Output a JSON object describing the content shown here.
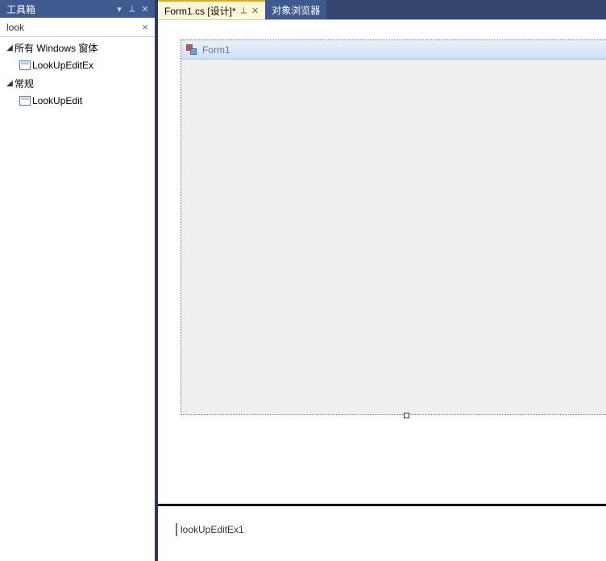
{
  "toolbox": {
    "title": "工具箱",
    "search_value": "look",
    "groups": [
      {
        "label": "所有 Windows 窗体",
        "items": [
          {
            "label": "LookUpEditEx"
          }
        ]
      },
      {
        "label": "常规",
        "items": [
          {
            "label": "LookUpEdit"
          }
        ]
      }
    ]
  },
  "tabs": {
    "active": "Form1.cs [设计]*",
    "inactive": "对象浏览器"
  },
  "designer": {
    "form_title": "Form1",
    "tray_component": "lookUpEditEx1"
  }
}
